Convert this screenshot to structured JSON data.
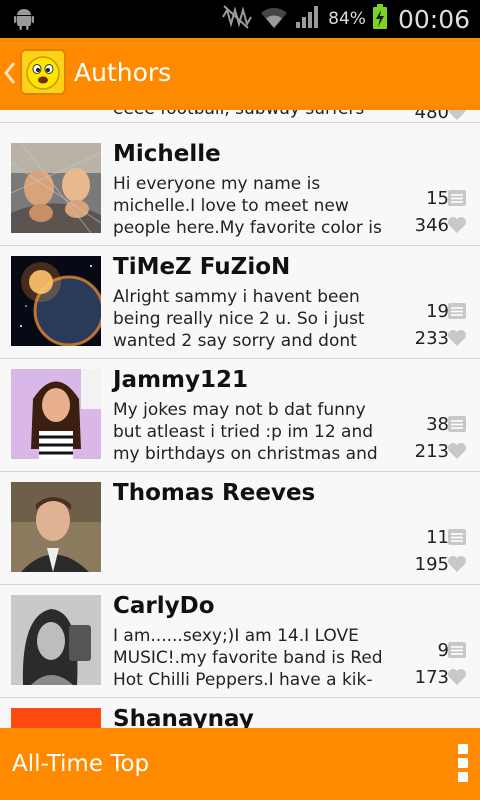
{
  "status_bar": {
    "battery_percent": "84%",
    "time": "00:06"
  },
  "action_bar": {
    "title": "Authors"
  },
  "authors": [
    {
      "name": "",
      "description": "eeee football, subway surfers",
      "comments": "",
      "likes": "480"
    },
    {
      "name": "Michelle",
      "description": "Hi everyone my name is michelle.I love to meet new people here.My favorite color is",
      "comments": "15",
      "likes": "346"
    },
    {
      "name": "TiMeZ FuZioN",
      "description": "Alright sammy i havent been being really nice 2 u. So i just wanted 2 say sorry and dont",
      "comments": "19",
      "likes": "233"
    },
    {
      "name": "Jammy121",
      "description": "My jokes may not b dat funny but atleast i tried :p im 12 and my birthdays on christmas and",
      "comments": "38",
      "likes": "213"
    },
    {
      "name": "Thomas Reeves",
      "description": "",
      "comments": "11",
      "likes": "195"
    },
    {
      "name": "CarlyDo",
      "description": "I am......sexy;)I am 14.I LOVE MUSIC!.my favorite band is Red Hot Chilli Peppers.I have a kik-",
      "comments": "9",
      "likes": "173"
    },
    {
      "name": "Shanaynay",
      "description": "",
      "comments": "",
      "likes": ""
    }
  ],
  "bottom_bar": {
    "title": "All-Time Top"
  },
  "icons": {
    "android": "android-icon",
    "mute": "mute-icon",
    "wifi": "wifi-icon",
    "signal": "signal-icon",
    "battery": "battery-charging-icon",
    "back": "chevron-left-icon",
    "logo": "smiley-logo-icon",
    "comments": "comment-icon",
    "likes": "heart-icon",
    "overflow": "overflow-menu-icon"
  },
  "colors": {
    "accent": "#ff8a00",
    "status_bar": "#000000",
    "background": "#f7f7f7"
  }
}
